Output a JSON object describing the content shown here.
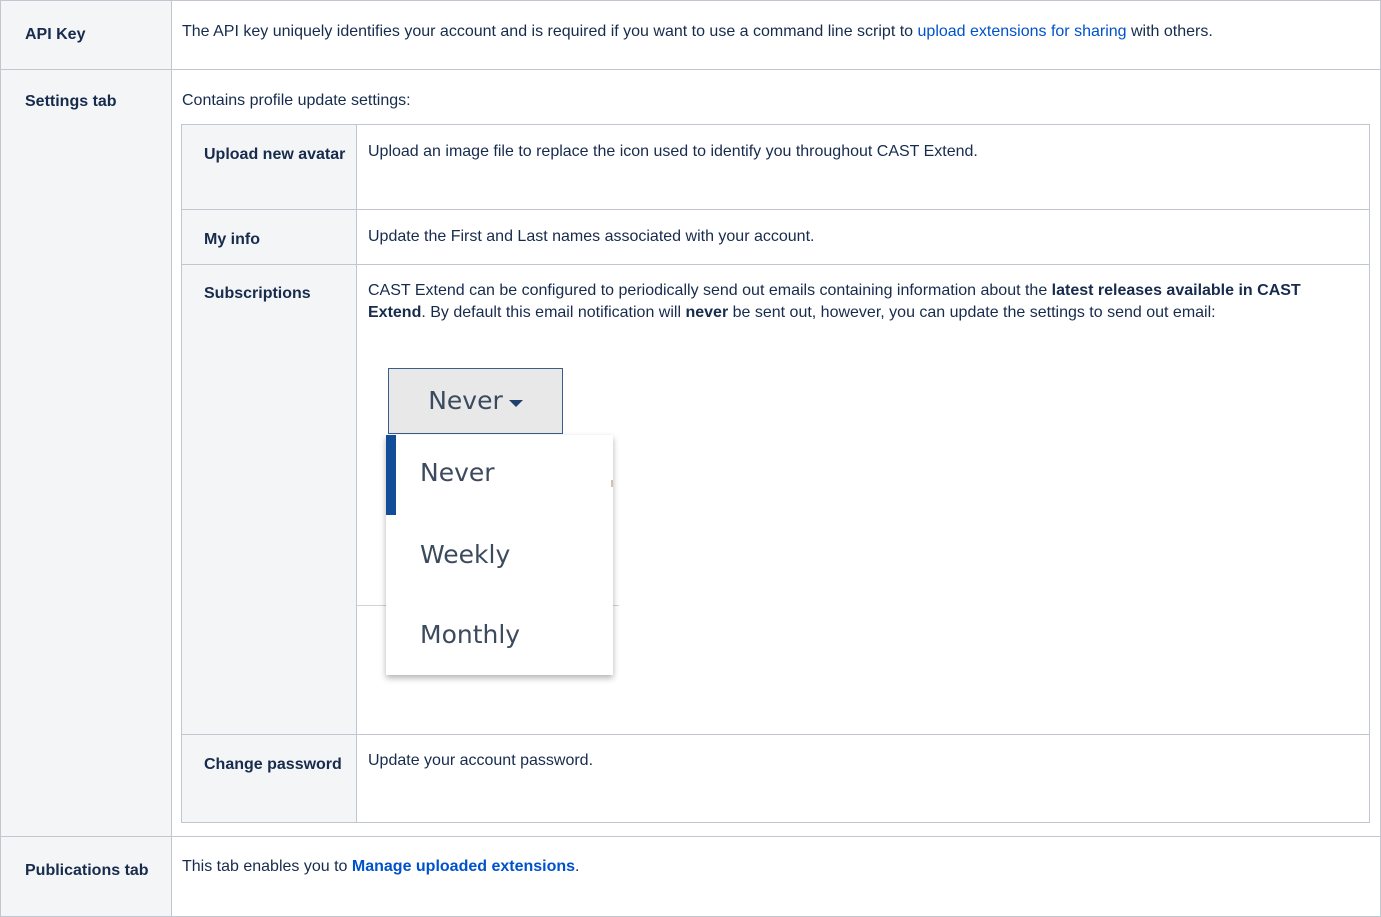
{
  "rows": {
    "api_key": {
      "label": "API Key",
      "text_before": "The API key uniquely identifies your account and is required if you want to use a command line script to ",
      "link": "upload extensions for sharing",
      "text_after": " with others."
    },
    "settings_tab": {
      "label": "Settings tab",
      "intro": "Contains profile update settings:",
      "sub_rows": {
        "upload_avatar": {
          "label": "Upload new avatar",
          "text": "Upload an image file to replace the icon used to identify you throughout CAST Extend."
        },
        "my_info": {
          "label": "My info",
          "text": "Update the First and Last names associated with your account."
        },
        "subscriptions": {
          "label": "Subscriptions",
          "text_1": "CAST Extend can be configured to periodically send out emails containing information about the ",
          "bold_1": "latest releases available in CAST Extend",
          "text_2": ". By default this email notification will ",
          "bold_2": "never",
          "text_3": " be sent out, however, you can update the settings to send out email:",
          "dropdown": {
            "selected": "Never",
            "options": [
              "Never",
              "Weekly",
              "Monthly"
            ],
            "accent_color": "#114d99"
          }
        },
        "change_password": {
          "label": "Change password",
          "text": "Update your account password."
        }
      }
    },
    "publications_tab": {
      "label": "Publications tab",
      "text_before": "This tab enables you to ",
      "link": "Manage uploaded extensions",
      "text_after": "."
    }
  }
}
